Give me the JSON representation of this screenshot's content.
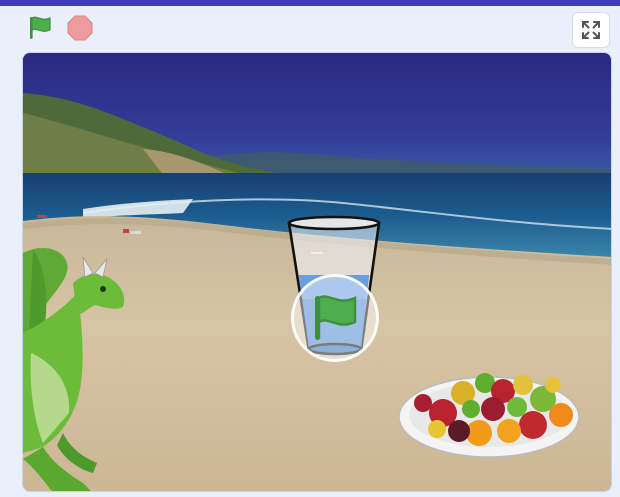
{
  "toolbar": {
    "green_flag_icon": "green-flag-icon",
    "stop_icon": "stop-sign-icon",
    "fullscreen_icon": "fullscreen-icon"
  },
  "stage": {
    "backdrop": "beach",
    "sprites": [
      "dragon",
      "glass",
      "fruit-platter"
    ],
    "overlay_icon": "green-flag-icon"
  },
  "colors": {
    "accent": "#3e3fae",
    "flag_green": "#4cae4c",
    "stop_red": "#ec9c9c",
    "sky": "#2f2f86",
    "sea": "#1f5f8f",
    "sand": "#d6c3a3"
  }
}
